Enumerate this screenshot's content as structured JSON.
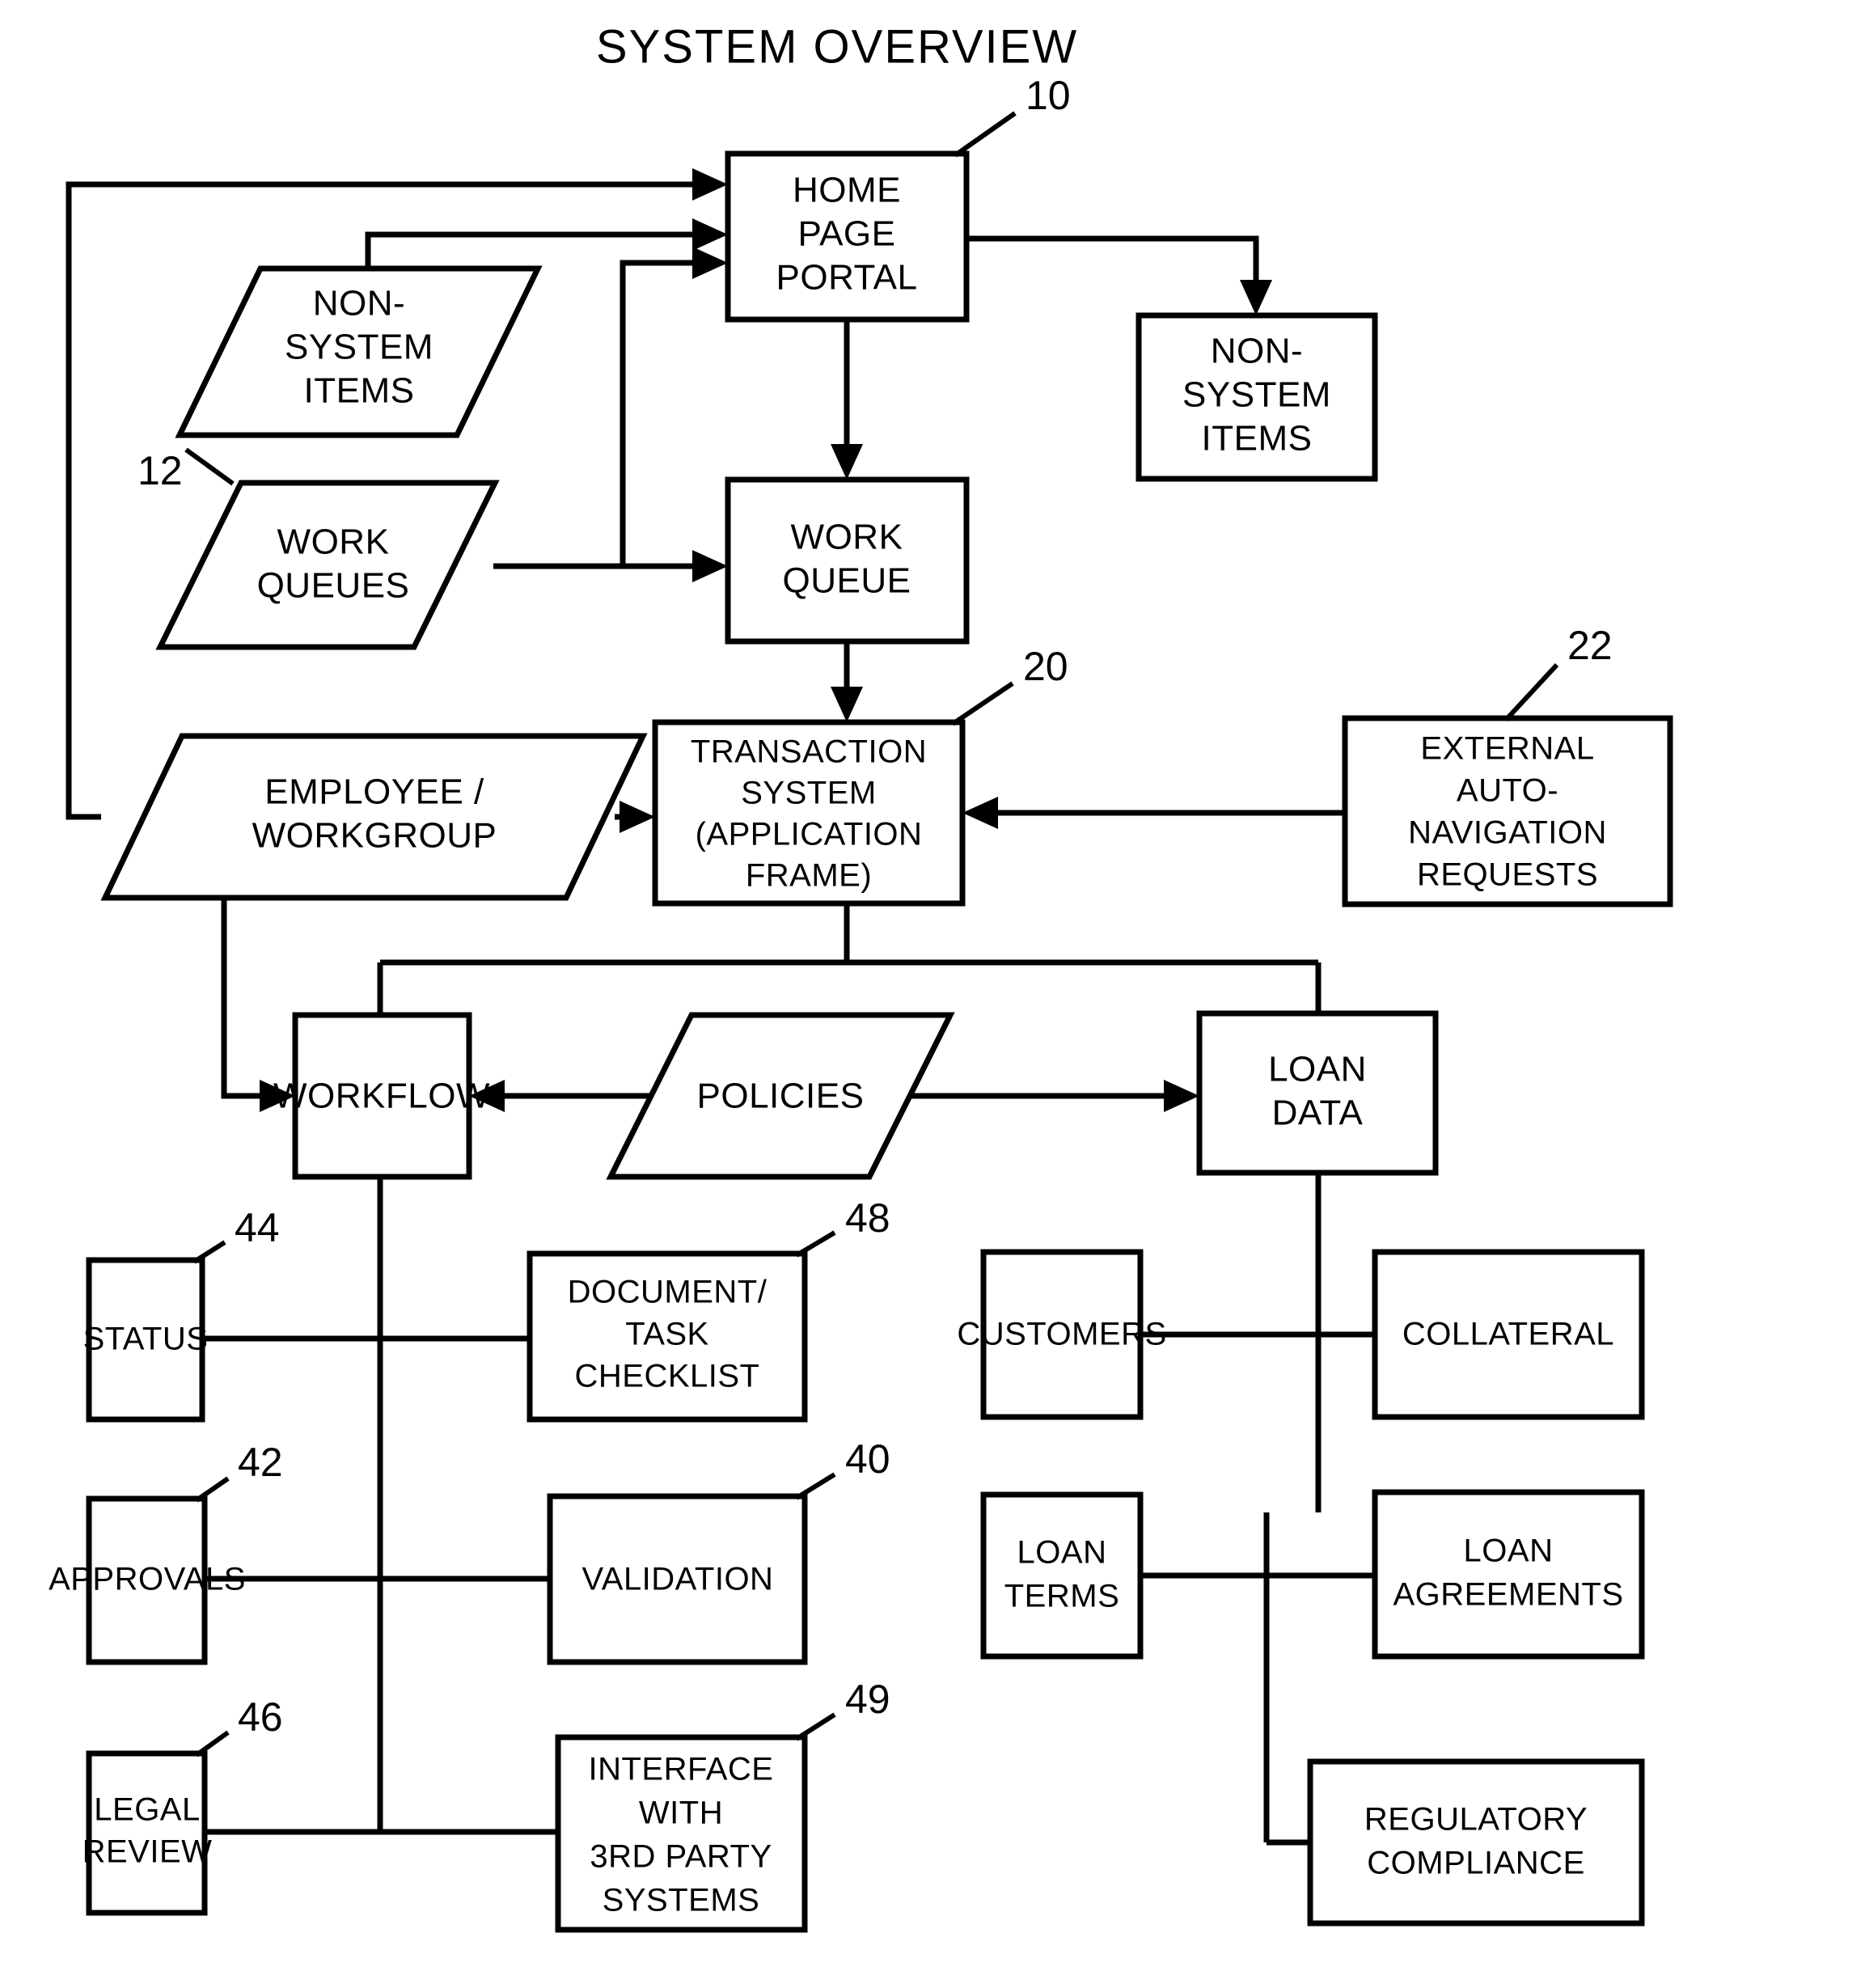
{
  "figure": {
    "title": "SYSTEM OVERVIEW"
  },
  "nodes": {
    "home_page_portal": {
      "label": "HOME\nPAGE\nPORTAL",
      "ref": "10",
      "shape": "rect"
    },
    "non_system_items_left": {
      "label": "NON-\nSYSTEM\nITEMS",
      "ref": "",
      "shape": "parallelogram"
    },
    "non_system_items_right": {
      "label": "NON-\nSYSTEM\nITEMS",
      "ref": "",
      "shape": "rect"
    },
    "work_queues": {
      "label": "WORK\nQUEUES",
      "ref": "12",
      "shape": "parallelogram"
    },
    "work_queue": {
      "label": "WORK\nQUEUE",
      "ref": "",
      "shape": "rect"
    },
    "transaction_system": {
      "label": "TRANSACTION\nSYSTEM\n(APPLICATION\nFRAME)",
      "ref": "20",
      "shape": "rect"
    },
    "external_auto_navigation_requests": {
      "label": "EXTERNAL\nAUTO-\nNAVIGATION\nREQUESTS",
      "ref": "22",
      "shape": "rect"
    },
    "employee_workgroup": {
      "label": "EMPLOYEE /\nWORKGROUP",
      "ref": "",
      "shape": "parallelogram"
    },
    "workflow": {
      "label": "WORKFLOW",
      "ref": "",
      "shape": "rect"
    },
    "policies": {
      "label": "POLICIES",
      "ref": "",
      "shape": "parallelogram"
    },
    "loan_data": {
      "label": "LOAN\nDATA",
      "ref": "",
      "shape": "rect"
    },
    "status": {
      "label": "STATUS",
      "ref": "44",
      "shape": "rect"
    },
    "document_task_checklist": {
      "label": "DOCUMENT/\nTASK\nCHECKLIST",
      "ref": "48",
      "shape": "rect"
    },
    "approvals": {
      "label": "APPROVALS",
      "ref": "42",
      "shape": "rect"
    },
    "validation": {
      "label": "VALIDATION",
      "ref": "40",
      "shape": "rect"
    },
    "legal_review": {
      "label": "LEGAL\nREVIEW",
      "ref": "46",
      "shape": "rect"
    },
    "interface_third_party": {
      "label": "INTERFACE\nWITH\n3RD PARTY\nSYSTEMS",
      "ref": "49",
      "shape": "rect"
    },
    "customers": {
      "label": "CUSTOMERS",
      "ref": "",
      "shape": "rect"
    },
    "collateral": {
      "label": "COLLATERAL",
      "ref": "",
      "shape": "rect"
    },
    "loan_terms": {
      "label": "LOAN\nTERMS",
      "ref": "",
      "shape": "rect"
    },
    "loan_agreements": {
      "label": "LOAN\nAGREEMENTS",
      "ref": "",
      "shape": "rect"
    },
    "regulatory_compliance": {
      "label": "REGULATORY\nCOMPLIANCE",
      "ref": "",
      "shape": "rect"
    }
  },
  "reference_numerals": [
    "10",
    "12",
    "20",
    "22",
    "40",
    "42",
    "44",
    "46",
    "48",
    "49"
  ],
  "colors": {
    "line": "#000000",
    "fill": "#ffffff",
    "text": "#000000"
  }
}
